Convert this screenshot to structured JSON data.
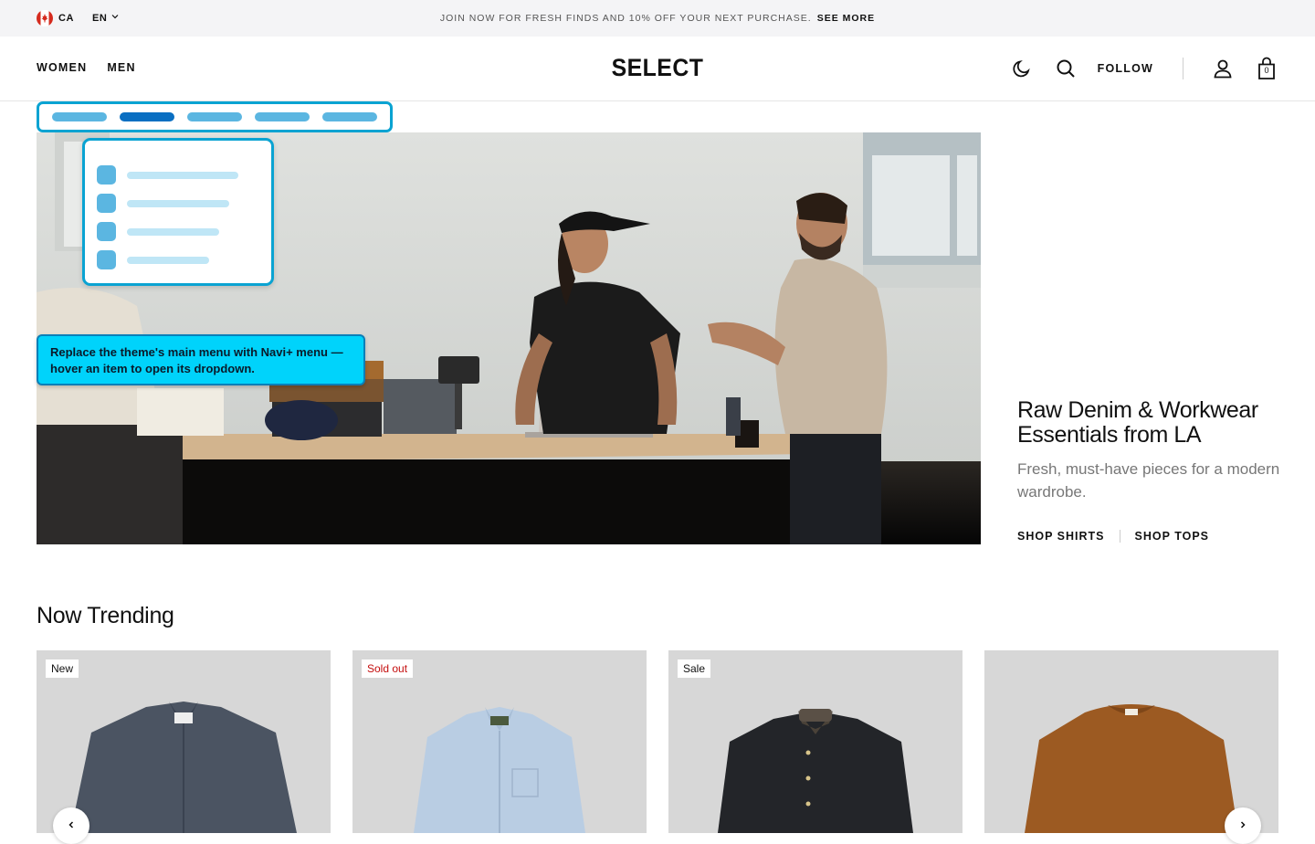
{
  "announcement": {
    "country": "CA",
    "language": "EN",
    "message": "JOIN NOW FOR FRESH FINDS AND 10% OFF YOUR NEXT PURCHASE.",
    "link": "SEE MORE"
  },
  "header": {
    "logo": "SELECT",
    "nav": [
      "WOMEN",
      "MEN"
    ],
    "follow": "FOLLOW",
    "cart_count": "0"
  },
  "overlay": {
    "callout": "Replace the theme's main menu with Navi+ menu — hover an item to open its dropdown."
  },
  "hero": {
    "title": "Raw Denim & Workwear Essentials from LA",
    "subtitle": "Fresh, must-have pieces for a modern wardrobe.",
    "links": [
      "SHOP SHIRTS",
      "SHOP TOPS"
    ]
  },
  "trending": {
    "title": "Now Trending",
    "products": [
      {
        "badge": "New",
        "badge_type": "new",
        "color": "#4a5360"
      },
      {
        "badge": "Sold out",
        "badge_type": "soldout",
        "color": "#b9cde3"
      },
      {
        "badge": "Sale",
        "badge_type": "sale",
        "color": "#23252b"
      },
      {
        "badge": "",
        "badge_type": "none",
        "color": "#9c5a22"
      }
    ]
  },
  "colors": {
    "accent": "#0aa3d2",
    "callout_bg": "#00d3fb",
    "sold_out": "#c40d0d"
  }
}
